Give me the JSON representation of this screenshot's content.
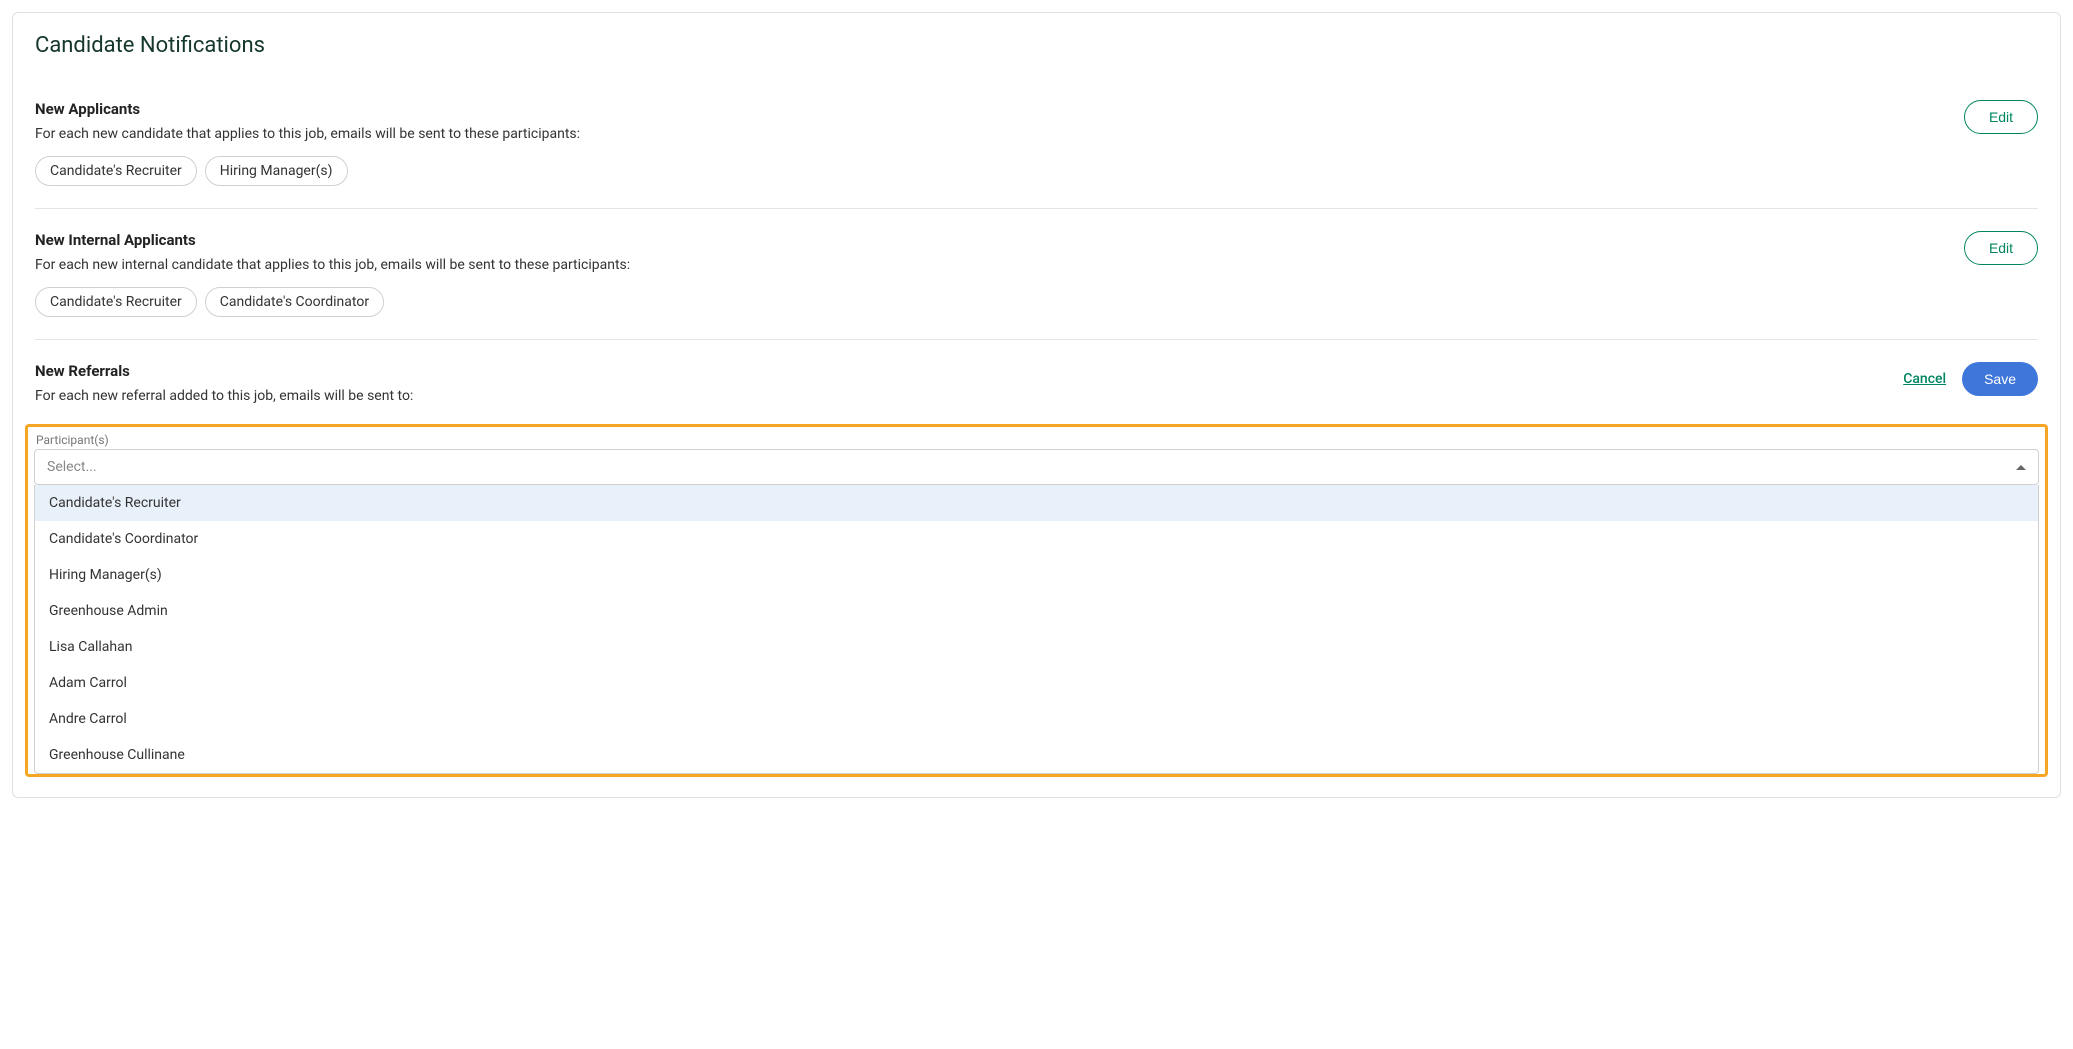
{
  "page": {
    "title": "Candidate Notifications"
  },
  "sections": {
    "new_applicants": {
      "title": "New Applicants",
      "description": "For each new candidate that applies to this job, emails will be sent to these participants:",
      "pills": [
        "Candidate's Recruiter",
        "Hiring Manager(s)"
      ],
      "edit_label": "Edit"
    },
    "new_internal_applicants": {
      "title": "New Internal Applicants",
      "description": "For each new internal candidate that applies to this job, emails will be sent to these participants:",
      "pills": [
        "Candidate's Recruiter",
        "Candidate's Coordinator"
      ],
      "edit_label": "Edit"
    },
    "new_referrals": {
      "title": "New Referrals",
      "description": "For each new referral added to this job, emails will be sent to:",
      "cancel_label": "Cancel",
      "save_label": "Save",
      "participants_label": "Participant(s)",
      "select_placeholder": "Select...",
      "options": [
        "Candidate's Recruiter",
        "Candidate's Coordinator",
        "Hiring Manager(s)",
        "Greenhouse Admin",
        "Lisa Callahan",
        "Adam Carrol",
        "Andre Carrol",
        "Greenhouse Cullinane"
      ]
    }
  }
}
